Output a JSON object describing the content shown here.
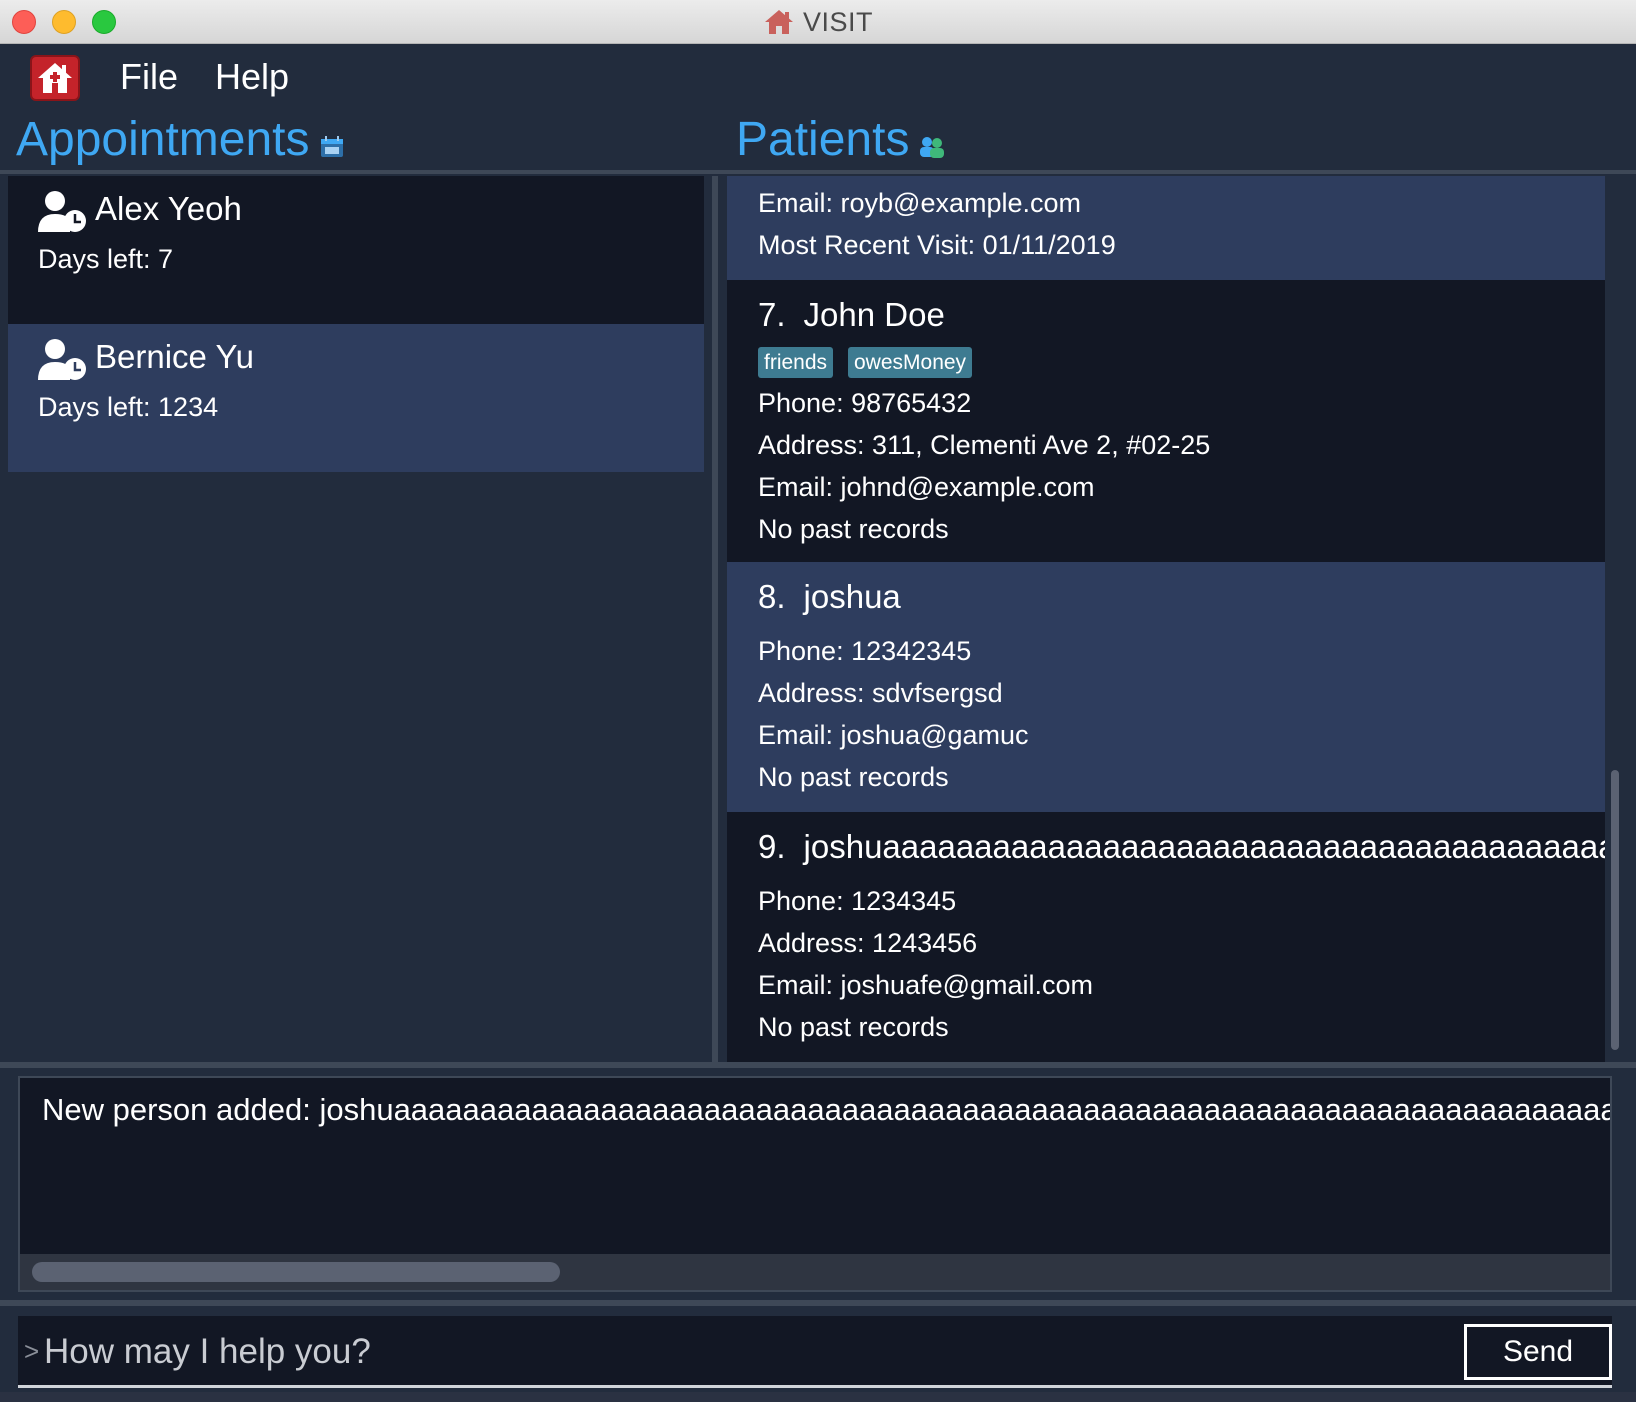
{
  "window": {
    "title": "VISIT"
  },
  "menu": {
    "file": "File",
    "help": "Help"
  },
  "sections": {
    "appointments": "Appointments",
    "patients": "Patients"
  },
  "appointments": [
    {
      "name": "Alex Yeoh",
      "days_left": "Days left: 7"
    },
    {
      "name": "Bernice Yu",
      "days_left": "Days left: 1234"
    }
  ],
  "patients": {
    "partial": {
      "email": "Email: royb@example.com",
      "recent_visit": "Most Recent Visit: 01/11/2019"
    },
    "items": [
      {
        "index": "7.",
        "name": "John Doe",
        "tags": [
          "friends",
          "owesMoney"
        ],
        "phone": "Phone: 98765432",
        "address": "Address: 311, Clementi Ave 2, #02-25",
        "email": "Email: johnd@example.com",
        "records": "No past records"
      },
      {
        "index": "8.",
        "name": "joshua",
        "phone": "Phone: 12342345",
        "address": "Address: sdvfsergsd",
        "email": "Email: joshua@gamuc",
        "records": "No past records"
      },
      {
        "index": "9.",
        "name": "joshuaaaaaaaaaaaaaaaaaaaaaaaaaaaaaaaaaaaaaaaa...",
        "phone": "Phone: 1234345",
        "address": "Address: 1243456",
        "email": "Email: joshuafe@gmail.com",
        "records": "No past records"
      }
    ]
  },
  "result": {
    "text": "New person added: joshuaaaaaaaaaaaaaaaaaaaaaaaaaaaaaaaaaaaaaaaaaaaaaaaaaaaaaaaaaaaaaaaaaaaaaaaaaaaaaaa"
  },
  "command": {
    "prompt": ">",
    "placeholder": "How may I help you?",
    "send_label": "Send"
  },
  "colors": {
    "accent": "#3fa8f3",
    "tag": "#3e7b91",
    "card_dark": "#121724",
    "card_light": "#2e3d5e",
    "background": "#222c3d"
  },
  "icons": {
    "app": "home-icon",
    "appointments": "calendar-icon",
    "patients": "people-icon",
    "appointment_item": "user-clock-icon"
  }
}
